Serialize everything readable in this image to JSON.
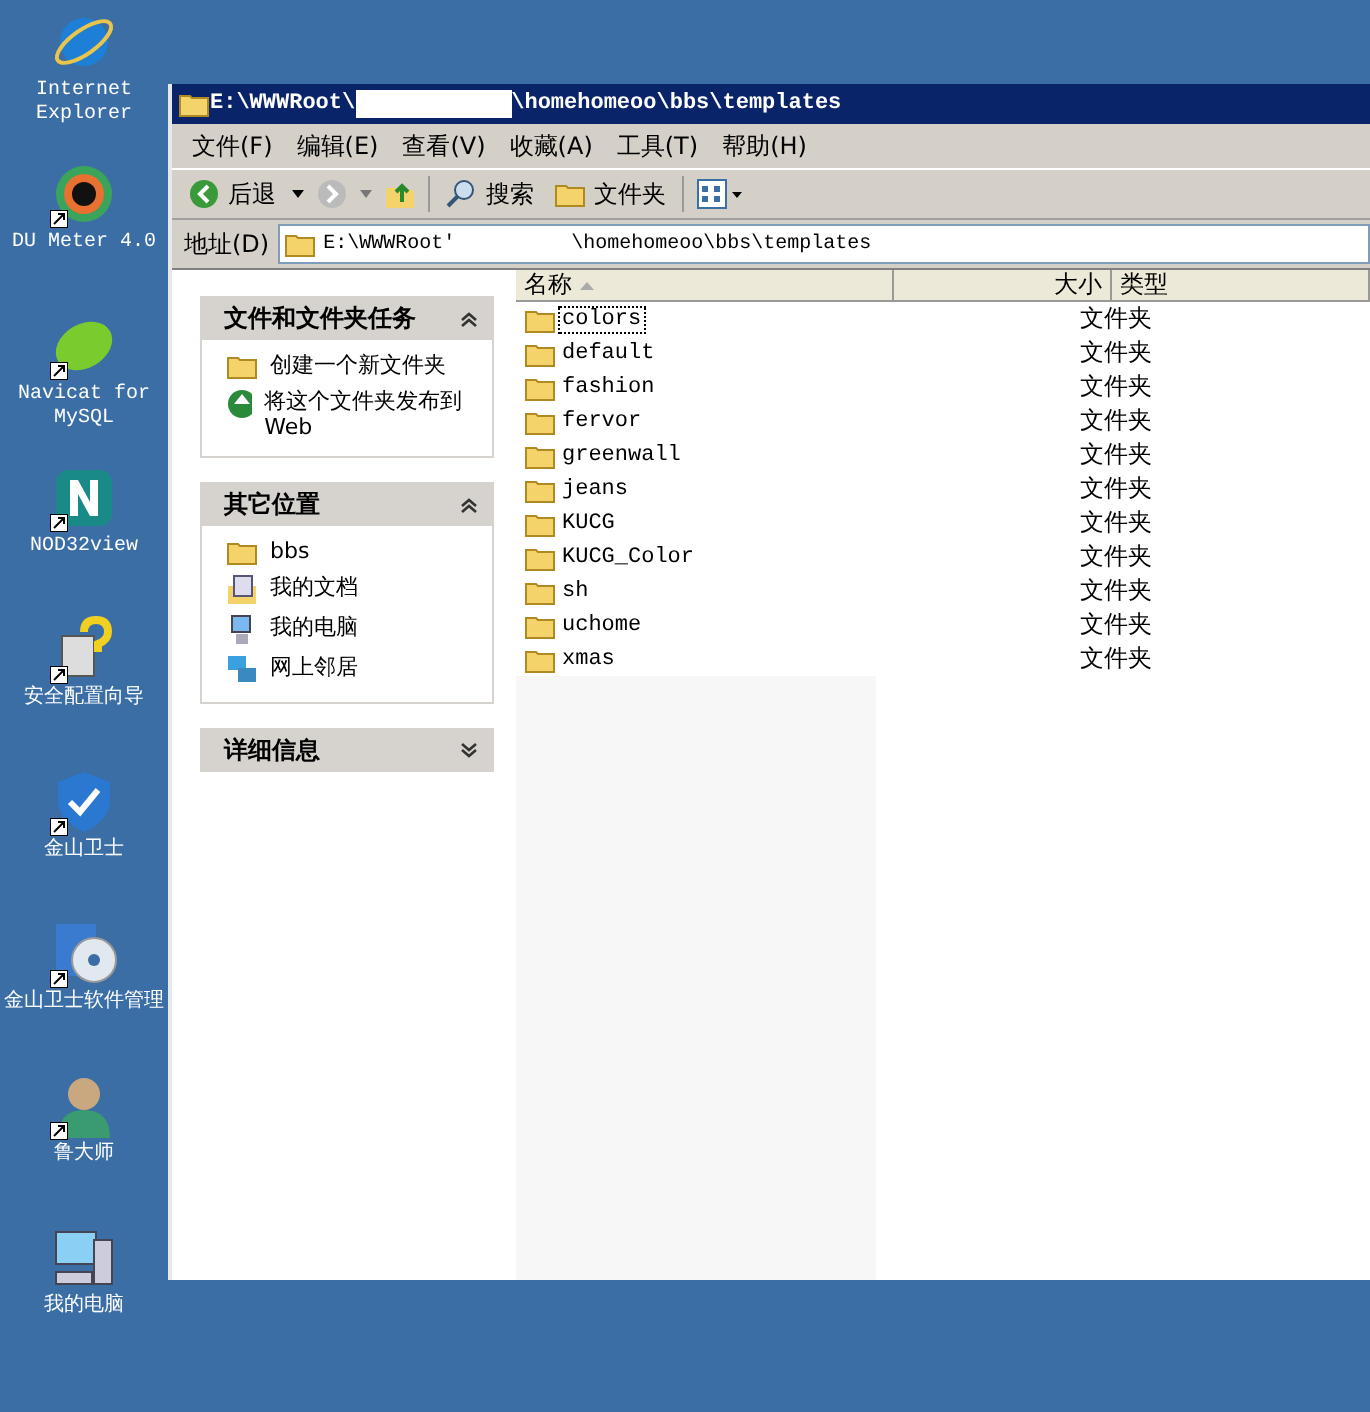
{
  "desktop_icons": [
    {
      "label": "Internet Explorer",
      "kind": "browser",
      "shortcut": false
    },
    {
      "label": "DU Meter 4.0",
      "kind": "meter",
      "shortcut": true
    },
    {
      "label": "Navicat for MySQL",
      "kind": "leaf",
      "shortcut": true
    },
    {
      "label": "NOD32view",
      "kind": "letter",
      "shortcut": true
    },
    {
      "label": "安全配置向导",
      "kind": "wizard",
      "shortcut": true
    },
    {
      "label": "金山卫士",
      "kind": "shield",
      "shortcut": true
    },
    {
      "label": "金山卫士软件管理",
      "kind": "disc",
      "shortcut": true
    },
    {
      "label": "鲁大师",
      "kind": "person",
      "shortcut": true
    },
    {
      "label": "我的电脑",
      "kind": "computer",
      "shortcut": false
    }
  ],
  "window": {
    "title_start": "E:\\WWWRoot\\",
    "title_end": "\\homehomeoo\\bbs\\templates",
    "menu": [
      "文件(F)",
      "编辑(E)",
      "查看(V)",
      "收藏(A)",
      "工具(T)",
      "帮助(H)"
    ],
    "toolbar": {
      "back": "后退",
      "search": "搜索",
      "folders": "文件夹"
    },
    "address": {
      "label": "地址(D)",
      "path_start": "E:\\WWWRoot'",
      "path_end": "\\homehomeoo\\bbs\\templates"
    }
  },
  "task_panels": [
    {
      "title": "文件和文件夹任务",
      "expanded": true,
      "items": [
        {
          "label": "创建一个新文件夹",
          "kind": "new-folder"
        },
        {
          "label": "将这个文件夹发布到 Web",
          "kind": "publish"
        }
      ]
    },
    {
      "title": "其它位置",
      "expanded": true,
      "items": [
        {
          "label": "bbs",
          "kind": "folder"
        },
        {
          "label": "我的文档",
          "kind": "documents"
        },
        {
          "label": "我的电脑",
          "kind": "computer"
        },
        {
          "label": "网上邻居",
          "kind": "network"
        }
      ]
    },
    {
      "title": "详细信息",
      "expanded": false
    }
  ],
  "file_list": {
    "columns": [
      "名称",
      "大小",
      "类型"
    ],
    "files": [
      {
        "name": "colors",
        "type": "文件夹",
        "selected": true
      },
      {
        "name": "default",
        "type": "文件夹",
        "selected": false
      },
      {
        "name": "fashion",
        "type": "文件夹",
        "selected": false
      },
      {
        "name": "fervor",
        "type": "文件夹",
        "selected": false
      },
      {
        "name": "greenwall",
        "type": "文件夹",
        "selected": false
      },
      {
        "name": "jeans",
        "type": "文件夹",
        "selected": false
      },
      {
        "name": "KUCG",
        "type": "文件夹",
        "selected": false
      },
      {
        "name": "KUCG_Color",
        "type": "文件夹",
        "selected": false
      },
      {
        "name": "sh",
        "type": "文件夹",
        "selected": false
      },
      {
        "name": "uchome",
        "type": "文件夹",
        "selected": false
      },
      {
        "name": "xmas",
        "type": "文件夹",
        "selected": false
      }
    ]
  }
}
